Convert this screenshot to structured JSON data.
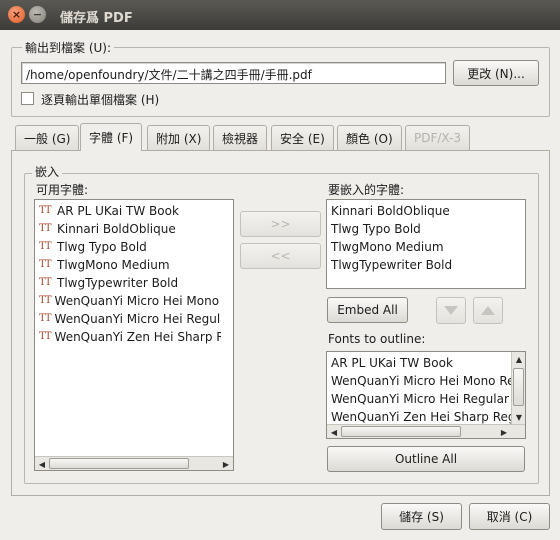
{
  "window": {
    "title": "儲存爲 PDF",
    "close_glyph": "×",
    "minimize_glyph": "−"
  },
  "output": {
    "group_label": "輸出到檔案 (U):",
    "path_value": "/home/openfoundry/文件/二十講之四手冊/手冊.pdf",
    "change_button": "更改 (N)...",
    "per_page_label": "逐頁輸出單個檔案 (H)",
    "per_page_checked": false
  },
  "tabs": [
    {
      "label": "一般 (G)",
      "active": false,
      "enabled": true
    },
    {
      "label": "字體 (F)",
      "active": true,
      "enabled": true
    },
    {
      "label": "附加 (X)",
      "active": false,
      "enabled": true
    },
    {
      "label": "檢視器",
      "active": false,
      "enabled": true
    },
    {
      "label": "安全 (E)",
      "active": false,
      "enabled": true
    },
    {
      "label": "顏色 (O)",
      "active": false,
      "enabled": true
    },
    {
      "label": "PDF/X-3",
      "active": false,
      "enabled": false
    }
  ],
  "embed": {
    "group_label": "嵌入",
    "available_label": "可用字體:",
    "available_fonts": [
      "AR PL UKai TW Book",
      "Kinnari BoldOblique",
      "Tlwg Typo Bold",
      "TlwgMono Medium",
      "TlwgTypewriter Bold",
      "WenQuanYi Micro Hei Mono Regular",
      "WenQuanYi Micro Hei Regular",
      "WenQuanYi Zen Hei Sharp Regular"
    ],
    "font_icon": "TT",
    "add_button": ">>",
    "remove_button": "<<",
    "embedded_label": "要嵌入的字體:",
    "embedded_fonts": [
      "Kinnari BoldOblique",
      "Tlwg Typo Bold",
      "TlwgMono Medium",
      "TlwgTypewriter Bold"
    ],
    "embed_all_button": "Embed All",
    "outline_label": "Fonts to outline:",
    "outline_fonts": [
      "AR PL UKai TW Book",
      "WenQuanYi Micro Hei Mono Regular",
      "WenQuanYi Micro Hei Regular",
      "WenQuanYi Zen Hei Sharp Regular"
    ],
    "outline_all_button": "Outline All"
  },
  "footer": {
    "save_button": "儲存 (S)",
    "cancel_button": "取消 (C)"
  }
}
